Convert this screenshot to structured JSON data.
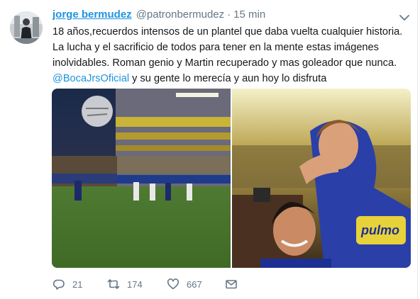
{
  "tweet": {
    "author": {
      "name": "jorge bermudez",
      "handle": "@patronbermudez"
    },
    "separator": "·",
    "time": "15 min",
    "text": {
      "before_mention": "18 años,recuerdos intensos de un plantel que daba vuelta cualquier historia. La lucha y el sacrificio de todos para tener en la mente estas imágenes inolvidables. Roman genio y Martin recuperado y mas goleador que nunca. ",
      "mention": "@BocaJrsOficial",
      "after_mention": " y su gente lo merecía y aun hoy lo disfruta"
    },
    "media": [
      {
        "icon": "photo-stadium-penalty"
      },
      {
        "icon": "photo-players-celebrating",
        "shirt_text": "pulmo"
      }
    ],
    "actions": {
      "replies": "21",
      "retweets": "174",
      "likes": "667"
    },
    "colors": {
      "link": "#1c94e0",
      "muted": "#657786",
      "text": "#14171a",
      "divider": "#e1e8ed"
    }
  }
}
